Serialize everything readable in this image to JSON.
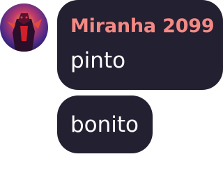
{
  "chat": {
    "avatar_icon": "user-avatar",
    "bubble_color": "#232031",
    "sender_color": "#f48984",
    "messages": [
      {
        "sender": "Miranha 2099",
        "text": "pinto"
      },
      {
        "text": "bonito"
      }
    ]
  }
}
